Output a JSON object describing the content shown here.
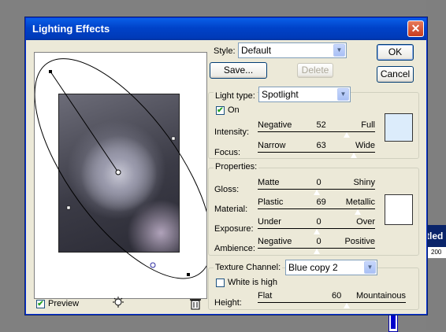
{
  "background": {
    "titlebar_text": "tled",
    "ruler_text": "200"
  },
  "dialog": {
    "title": "Lighting Effects",
    "close_label": "✕",
    "ok_label": "OK",
    "cancel_label": "Cancel"
  },
  "style": {
    "label": "Style:",
    "value": "Default",
    "save_label": "Save...",
    "delete_label": "Delete"
  },
  "light_type": {
    "group_label": "Light type:",
    "value": "Spotlight",
    "on_label": "On",
    "on_checked": true,
    "color": "#dcecfb",
    "sliders": [
      {
        "label": "Intensity:",
        "min_label": "Negative",
        "value": "52",
        "max_label": "Full",
        "fraction": 0.76
      },
      {
        "label": "Focus:",
        "min_label": "Narrow",
        "value": "63",
        "max_label": "Wide",
        "fraction": 0.82
      }
    ]
  },
  "properties": {
    "group_label": "Properties:",
    "color": "#ffffff",
    "sliders": [
      {
        "label": "Gloss:",
        "min_label": "Matte",
        "value": "0",
        "max_label": "Shiny",
        "fraction": 0.5
      },
      {
        "label": "Material:",
        "min_label": "Plastic",
        "value": "69",
        "max_label": "Metallic",
        "fraction": 0.85
      },
      {
        "label": "Exposure:",
        "min_label": "Under",
        "value": "0",
        "max_label": "Over",
        "fraction": 0.5
      },
      {
        "label": "Ambience:",
        "min_label": "Negative",
        "value": "0",
        "max_label": "Positive",
        "fraction": 0.5
      }
    ]
  },
  "texture": {
    "group_label": "Texture Channel:",
    "value": "Blue copy 2",
    "white_is_high_label": "White is high",
    "white_is_high_checked": false,
    "slider": {
      "label": "Height:",
      "min_label": "Flat",
      "value": "60",
      "max_label": "Mountainous",
      "fraction": 0.6
    }
  },
  "preview": {
    "label": "Preview",
    "checked": true
  },
  "icons": {
    "light_bulb": "light-bulb-icon",
    "trash": "trash-icon"
  }
}
